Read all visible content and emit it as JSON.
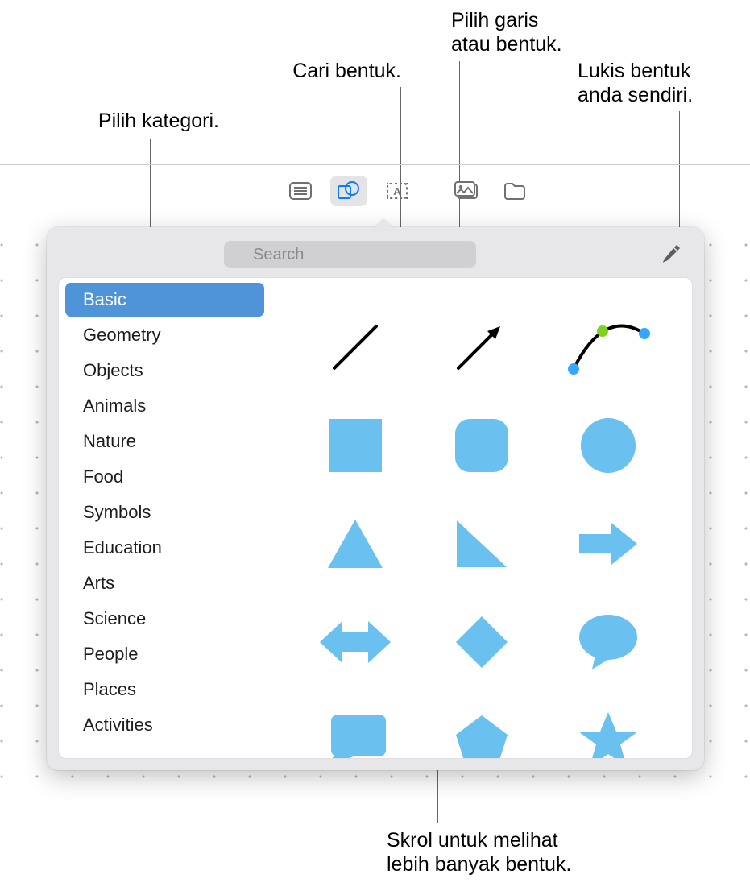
{
  "callouts": {
    "pick_category": "Pilih kategori.",
    "search_shape": "Cari bentuk.",
    "pick_line_shape": "Pilih garis\natau bentuk.",
    "draw_own": "Lukis bentuk\nanda sendiri.",
    "scroll_more": "Skrol untuk melihat\nlebih banyak bentuk."
  },
  "search": {
    "placeholder": "Search"
  },
  "sidebar": {
    "items": [
      {
        "label": "Basic",
        "selected": true
      },
      {
        "label": "Geometry"
      },
      {
        "label": "Objects"
      },
      {
        "label": "Animals"
      },
      {
        "label": "Nature"
      },
      {
        "label": "Food"
      },
      {
        "label": "Symbols"
      },
      {
        "label": "Education"
      },
      {
        "label": "Arts"
      },
      {
        "label": "Science"
      },
      {
        "label": "People"
      },
      {
        "label": "Places"
      },
      {
        "label": "Activities"
      }
    ]
  },
  "shapes": [
    {
      "name": "line-shape"
    },
    {
      "name": "arrow-line-shape"
    },
    {
      "name": "curve-editable-shape"
    },
    {
      "name": "square-shape"
    },
    {
      "name": "rounded-square-shape"
    },
    {
      "name": "circle-shape"
    },
    {
      "name": "triangle-shape"
    },
    {
      "name": "right-triangle-shape"
    },
    {
      "name": "arrow-right-shape"
    },
    {
      "name": "arrow-both-shape"
    },
    {
      "name": "diamond-shape"
    },
    {
      "name": "speech-bubble-shape"
    },
    {
      "name": "callout-rect-shape"
    },
    {
      "name": "pentagon-shape"
    },
    {
      "name": "star-shape"
    }
  ]
}
